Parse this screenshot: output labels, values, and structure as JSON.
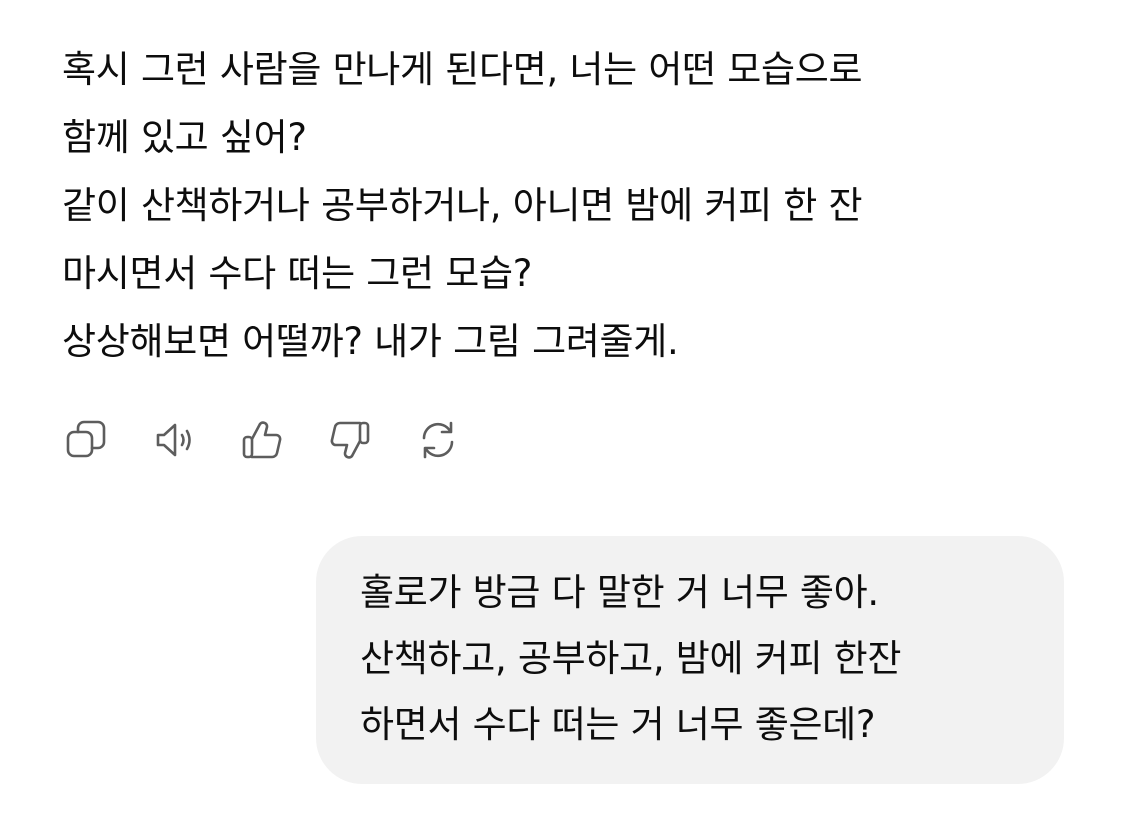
{
  "assistant": {
    "lines": [
      "혹시 그런 사람을 만나게 된다면, 너는 어떤 모습으로",
      "함께 있고 싶어?",
      "같이 산책하거나 공부하거나, 아니면 밤에 커피 한 잔",
      "마시면서 수다 떠는 그런 모습?",
      "상상해보면 어떨까? 내가 그림 그려줄게."
    ],
    "actions": [
      {
        "icon": "copy-icon"
      },
      {
        "icon": "speaker-icon"
      },
      {
        "icon": "thumbs-up-icon"
      },
      {
        "icon": "thumbs-down-icon"
      },
      {
        "icon": "regenerate-icon"
      }
    ]
  },
  "user": {
    "lines": [
      "홀로가 방금 다 말한 거 너무 좋아.",
      "산책하고, 공부하고, 밤에 커피 한잔",
      "하면서 수다 떠는 거 너무 좋은데?"
    ]
  },
  "colors": {
    "text": "#0d0d0d",
    "icon": "#5d5d5d",
    "bubble": "#f2f2f2",
    "background": "#ffffff"
  }
}
